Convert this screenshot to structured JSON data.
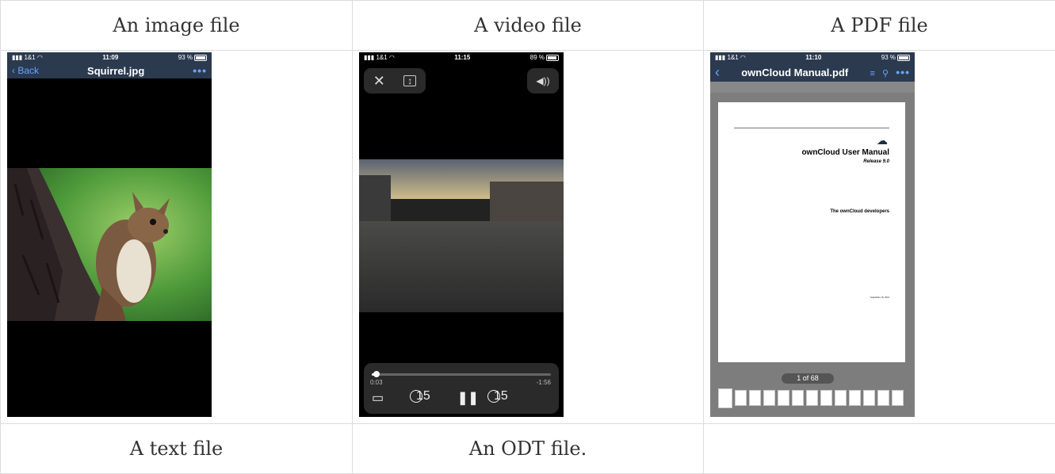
{
  "headers": {
    "image": "An image file",
    "video": "A video file",
    "pdf": "A PDF file",
    "text": "A text file",
    "odt": "An ODT file."
  },
  "image_viewer": {
    "carrier": "1&1",
    "time": "11:09",
    "battery": "93 %",
    "back_label": "Back",
    "title": "Squirrel.jpg",
    "more": "•••"
  },
  "video_player": {
    "carrier": "1&1",
    "time": "11:15",
    "battery": "89 %",
    "elapsed": "0:03",
    "remaining": "-1:56",
    "progress": 0.025,
    "skip_back": "15",
    "skip_fwd": "15"
  },
  "pdf_viewer": {
    "carrier": "1&1",
    "time": "11:10",
    "battery": "93 %",
    "title": "ownCloud Manual.pdf",
    "more": "•••",
    "page_title": "ownCloud User Manual",
    "release": "Release 9.0",
    "authors": "The ownCloud developers",
    "date": "September 19, 2016",
    "page_indicator": "1 of 68"
  }
}
